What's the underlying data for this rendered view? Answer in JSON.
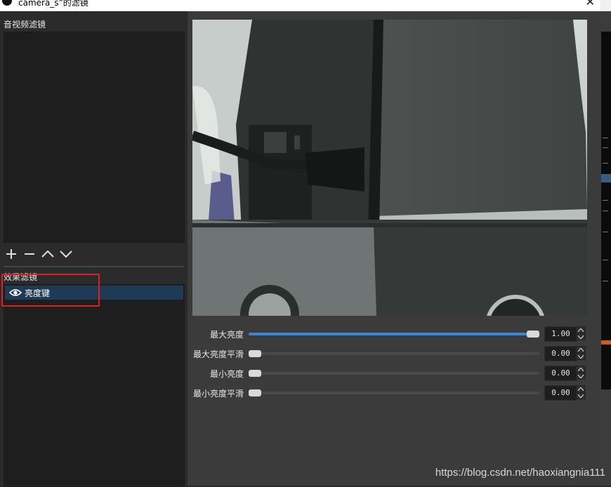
{
  "window": {
    "title": "camera_s”的滤镜",
    "close_glyph": "✕"
  },
  "left": {
    "audio_filters_label": "音视频滤镜",
    "effect_filters_label": "效果滤镜",
    "effect_filters": [
      {
        "label": "亮度键",
        "visible": true,
        "icon": "eye-icon"
      }
    ],
    "toolbar": [
      "add-icon",
      "remove-icon",
      "move-up-icon",
      "move-down-icon"
    ]
  },
  "properties": [
    {
      "label": "最大亮度",
      "value": "1.00",
      "fraction": 1.0
    },
    {
      "label": "最大亮度平滑",
      "value": "0.00",
      "fraction": 0.0
    },
    {
      "label": "最小亮度",
      "value": "0.00",
      "fraction": 0.0
    },
    {
      "label": "最小亮度平滑",
      "value": "0.00",
      "fraction": 0.0
    }
  ],
  "watermark": "https://blog.csdn.net/haoxiangnia111",
  "colors": {
    "accent": "#3a86d0",
    "selection": "#1f3a55",
    "annotation_box": "#e02020"
  }
}
